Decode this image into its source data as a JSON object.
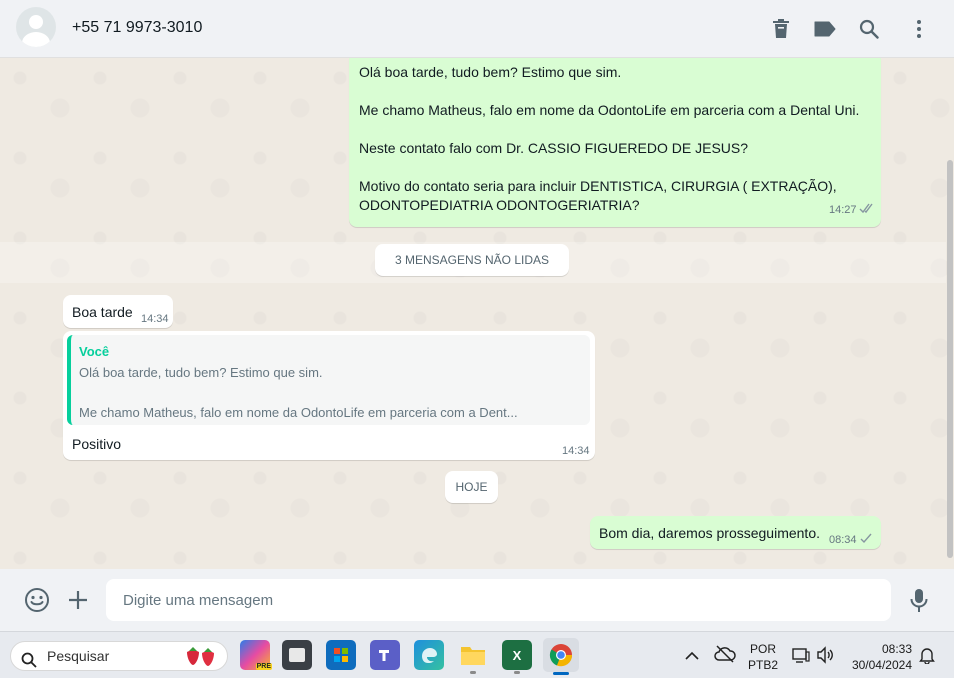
{
  "header": {
    "contact_name": "+55 71 9973-3010"
  },
  "messages": {
    "outgoing_1": {
      "line1": "Olá boa tarde, tudo bem? Estimo que sim.",
      "line2": "Me chamo Matheus, falo em nome da OdontoLife em parceria com a Dental Uni.",
      "line3": "Neste contato falo com Dr. CASSIO FIGUEREDO DE JESUS?",
      "line4a": "Motivo do contato seria para incluir DENTISTICA, CIRURGIA ( EXTRAÇÃO),",
      "line4b": "ODONTOPEDIATRIA ODONTOGERIATRIA?",
      "time": "14:27"
    },
    "unread_label": "3 MENSAGENS NÃO LIDAS",
    "incoming_1": {
      "text": "Boa tarde",
      "time": "14:34"
    },
    "incoming_2": {
      "quote_author": "Você",
      "quote_line1": "Olá boa tarde, tudo bem? Estimo que sim.",
      "quote_line2": "Me chamo Matheus, falo em nome da OdontoLife em parceria com a Dent...",
      "text": "Positivo",
      "time": "14:34"
    },
    "date_label": "HOJE",
    "outgoing_2": {
      "text": "Bom dia, daremos prosseguimento.",
      "time": "08:34"
    }
  },
  "composer": {
    "placeholder": "Digite uma mensagem"
  },
  "taskbar": {
    "search_label": "Pesquisar",
    "lang_line1": "POR",
    "lang_line2": "PTB2",
    "clock_time": "08:33",
    "clock_date": "30/04/2024",
    "copilot_badge": "PRE"
  },
  "colors": {
    "outgoing_bubble": "#d9fdd3",
    "incoming_bubble": "#ffffff",
    "quote_accent": "#06cf9c",
    "read_ticks": "#53bdeb",
    "sent_tick": "#8696a0"
  }
}
